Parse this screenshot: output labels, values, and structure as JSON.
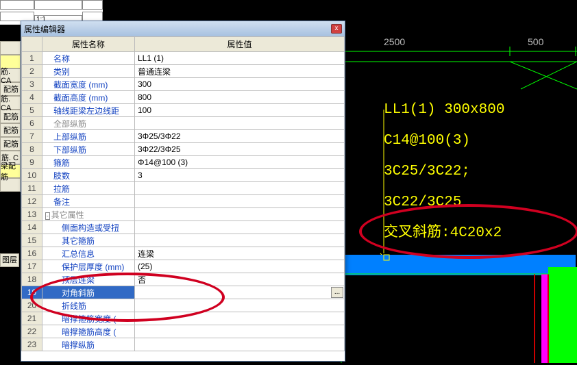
{
  "left_buttons": [
    {
      "label": "",
      "y": false
    },
    {
      "label": "",
      "y": true
    },
    {
      "label": "筋. CA",
      "y": false
    },
    {
      "label": "配筋",
      "y": false
    },
    {
      "label": "筋. CA",
      "y": false
    },
    {
      "label": "配筋",
      "y": false
    },
    {
      "label": "配筋",
      "y": false
    },
    {
      "label": "配筋",
      "y": false
    },
    {
      "label": "筋. C",
      "y": false
    },
    {
      "label": "梁配筋",
      "y": true
    },
    {
      "label": "",
      "y": false
    }
  ],
  "layer_label": "图层",
  "top_ratio": "1:1",
  "window": {
    "title": "属性编辑器",
    "close": "x",
    "headers": {
      "name": "属性名称",
      "value": "属性值"
    },
    "edit_btn": "...",
    "rows": [
      {
        "n": "1",
        "name": "名称",
        "val": "LL1 (1)",
        "cls": ""
      },
      {
        "n": "2",
        "name": "类别",
        "val": "普通连梁",
        "cls": ""
      },
      {
        "n": "3",
        "name": "截面宽度 (mm)",
        "val": "300",
        "cls": ""
      },
      {
        "n": "4",
        "name": "截面高度 (mm)",
        "val": "800",
        "cls": ""
      },
      {
        "n": "5",
        "name": "轴线距梁左边线距",
        "val": "100",
        "cls": ""
      },
      {
        "n": "6",
        "name": "全部纵筋",
        "val": "",
        "cls": "gray"
      },
      {
        "n": "7",
        "name": "上部纵筋",
        "val": "3Φ25/3Φ22",
        "cls": ""
      },
      {
        "n": "8",
        "name": "下部纵筋",
        "val": "3Φ22/3Φ25",
        "cls": ""
      },
      {
        "n": "9",
        "name": "箍筋",
        "val": "Φ14@100 (3)",
        "cls": ""
      },
      {
        "n": "10",
        "name": "肢数",
        "val": "3",
        "cls": ""
      },
      {
        "n": "11",
        "name": "拉筋",
        "val": "",
        "cls": ""
      },
      {
        "n": "12",
        "name": "备注",
        "val": "",
        "cls": ""
      },
      {
        "n": "13",
        "name": "其它属性",
        "val": "",
        "cls": "gray",
        "expander": true
      },
      {
        "n": "14",
        "name": "侧面构造或受扭",
        "val": "",
        "cls": "",
        "indent": 2
      },
      {
        "n": "15",
        "name": "其它箍筋",
        "val": "",
        "cls": "",
        "indent": 2
      },
      {
        "n": "16",
        "name": "汇总信息",
        "val": "连梁",
        "cls": "",
        "indent": 2
      },
      {
        "n": "17",
        "name": "保护层厚度 (mm)",
        "val": "(25)",
        "cls": "",
        "indent": 2
      },
      {
        "n": "18",
        "name": "顶层连梁",
        "val": "否",
        "cls": "",
        "indent": 2
      },
      {
        "n": "19",
        "name": "对角斜筋",
        "val": "",
        "cls": "",
        "indent": 2,
        "selected": true
      },
      {
        "n": "20",
        "name": "折线筋",
        "val": "",
        "cls": "",
        "indent": 2
      },
      {
        "n": "21",
        "name": "暗撑箍筋宽度 (",
        "val": "",
        "cls": "",
        "indent": 2
      },
      {
        "n": "22",
        "name": "暗撑箍筋高度 (",
        "val": "",
        "cls": "",
        "indent": 2
      },
      {
        "n": "23",
        "name": "暗撑纵筋",
        "val": "",
        "cls": "",
        "indent": 2
      }
    ]
  },
  "cad": {
    "dims": [
      "2500",
      "500"
    ],
    "labels": [
      "LL1(1) 300x800",
      "C14@100(3)",
      "3C25/3C22;",
      "3C22/3C25",
      "交叉斜筋:4C20x2"
    ]
  }
}
